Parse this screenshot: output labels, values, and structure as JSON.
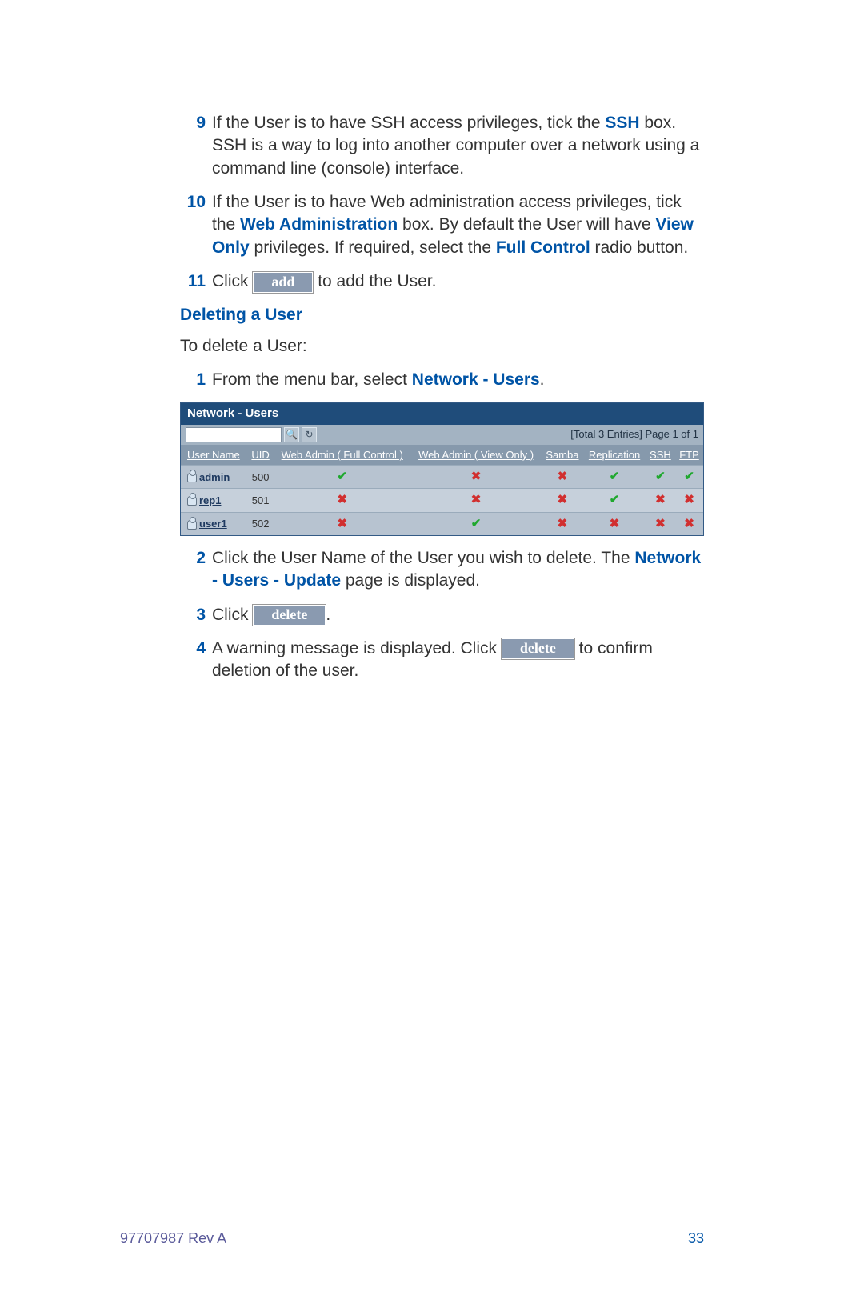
{
  "steps_upper": {
    "s9": {
      "num": "9",
      "t1": "If the User is to have SSH access privileges, tick the ",
      "ssh": "SSH",
      "t2": " box. SSH is a way to log into another computer over a network using a command line (console) interface."
    },
    "s10": {
      "num": "10",
      "t1": "If the User is to have Web administration access privileges, tick the ",
      "web_admin": "Web Administration",
      "t2": " box. By default the User will have ",
      "view_only": "View Only",
      "t3": " privileges. If required, select the ",
      "full_control": "Full Control",
      "t4": " radio button."
    },
    "s11": {
      "num": "11",
      "click": "Click ",
      "btn": "add",
      "rest": " to add the User."
    }
  },
  "subheading": "Deleting a User",
  "intro_delete": "To delete a User:",
  "steps_delete": {
    "d1": {
      "num": "1",
      "t1": "From the menu bar, select ",
      "link": "Network - Users",
      "t2": "."
    },
    "d2": {
      "num": "2",
      "t1": "Click the User Name of the User you wish to delete. The ",
      "link": "Network - Users - Update",
      "t2": " page is displayed."
    },
    "d3": {
      "num": "3",
      "click": "Click ",
      "btn": "delete",
      "rest": "."
    },
    "d4": {
      "num": "4",
      "t1": "A warning message is displayed. Click ",
      "btn": "delete",
      "t2": " to confirm deletion of the user."
    }
  },
  "panel": {
    "title": "Network - Users",
    "info": "[Total 3 Entries] Page 1 of 1",
    "headers": {
      "user": "User Name",
      "uid": "UID",
      "wa_full": "Web Admin ( Full Control )",
      "wa_view": "Web Admin ( View Only )",
      "samba": "Samba",
      "repl": "Replication",
      "ssh": "SSH",
      "ftp": "FTP"
    },
    "rows": [
      {
        "name": "admin",
        "uid": "500",
        "wa_full": true,
        "wa_view": false,
        "samba": false,
        "repl": true,
        "ssh": true,
        "ftp": true
      },
      {
        "name": "rep1",
        "uid": "501",
        "wa_full": false,
        "wa_view": false,
        "samba": false,
        "repl": true,
        "ssh": false,
        "ftp": false
      },
      {
        "name": "user1",
        "uid": "502",
        "wa_full": false,
        "wa_view": true,
        "samba": false,
        "repl": false,
        "ssh": false,
        "ftp": false
      }
    ]
  },
  "footer": {
    "left": "97707987 Rev A",
    "right": "33"
  }
}
